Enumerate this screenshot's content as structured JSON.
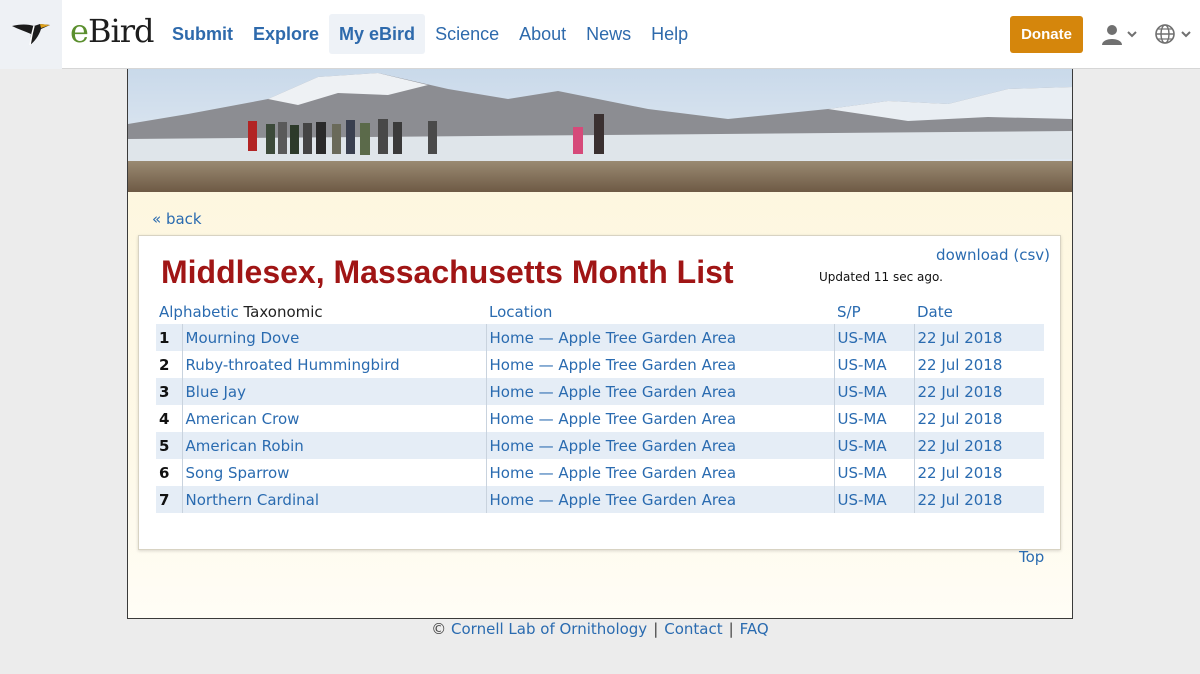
{
  "brand": {
    "name": "eBird",
    "e": "e",
    "rest": "Bird"
  },
  "nav": [
    {
      "label": "Submit",
      "bold": true
    },
    {
      "label": "Explore",
      "bold": true
    },
    {
      "label": "My eBird",
      "bold": true,
      "active": true
    },
    {
      "label": "Science"
    },
    {
      "label": "About"
    },
    {
      "label": "News"
    },
    {
      "label": "Help"
    }
  ],
  "donate_label": "Donate",
  "icons": {
    "logo": "cardinal-bird-logo",
    "user": "user-icon",
    "globe": "globe-icon",
    "chevron": "chevron-down-icon"
  },
  "back_label": "« back",
  "page": {
    "title": "Middlesex, Massachusetts Month List",
    "download_label": "download (csv)",
    "updated": "Updated 11 sec ago."
  },
  "table": {
    "sort_alpha": "Alphabetic",
    "sort_tax": "Taxonomic",
    "headers": {
      "location": "Location",
      "sp": "S/P",
      "date": "Date"
    },
    "rows": [
      {
        "n": "1",
        "species": "Mourning Dove",
        "location": "Home — Apple Tree Garden Area",
        "sp": "US-MA",
        "date": "22 Jul 2018"
      },
      {
        "n": "2",
        "species": "Ruby-throated Hummingbird",
        "location": "Home — Apple Tree Garden Area",
        "sp": "US-MA",
        "date": "22 Jul 2018"
      },
      {
        "n": "3",
        "species": "Blue Jay",
        "location": "Home — Apple Tree Garden Area",
        "sp": "US-MA",
        "date": "22 Jul 2018"
      },
      {
        "n": "4",
        "species": "American Crow",
        "location": "Home — Apple Tree Garden Area",
        "sp": "US-MA",
        "date": "22 Jul 2018"
      },
      {
        "n": "5",
        "species": "American Robin",
        "location": "Home — Apple Tree Garden Area",
        "sp": "US-MA",
        "date": "22 Jul 2018"
      },
      {
        "n": "6",
        "species": "Song Sparrow",
        "location": "Home — Apple Tree Garden Area",
        "sp": "US-MA",
        "date": "22 Jul 2018"
      },
      {
        "n": "7",
        "species": "Northern Cardinal",
        "location": "Home — Apple Tree Garden Area",
        "sp": "US-MA",
        "date": "22 Jul 2018"
      }
    ]
  },
  "top_label": "Top",
  "footer": {
    "copyright": "©",
    "cornell": "Cornell Lab of Ornithology",
    "contact": "Contact",
    "faq": "FAQ",
    "sep": "|"
  },
  "colors": {
    "title": "#a01515",
    "link": "#2a6bb0",
    "donate": "#d5860c",
    "row_alt": "#e5edf6"
  }
}
